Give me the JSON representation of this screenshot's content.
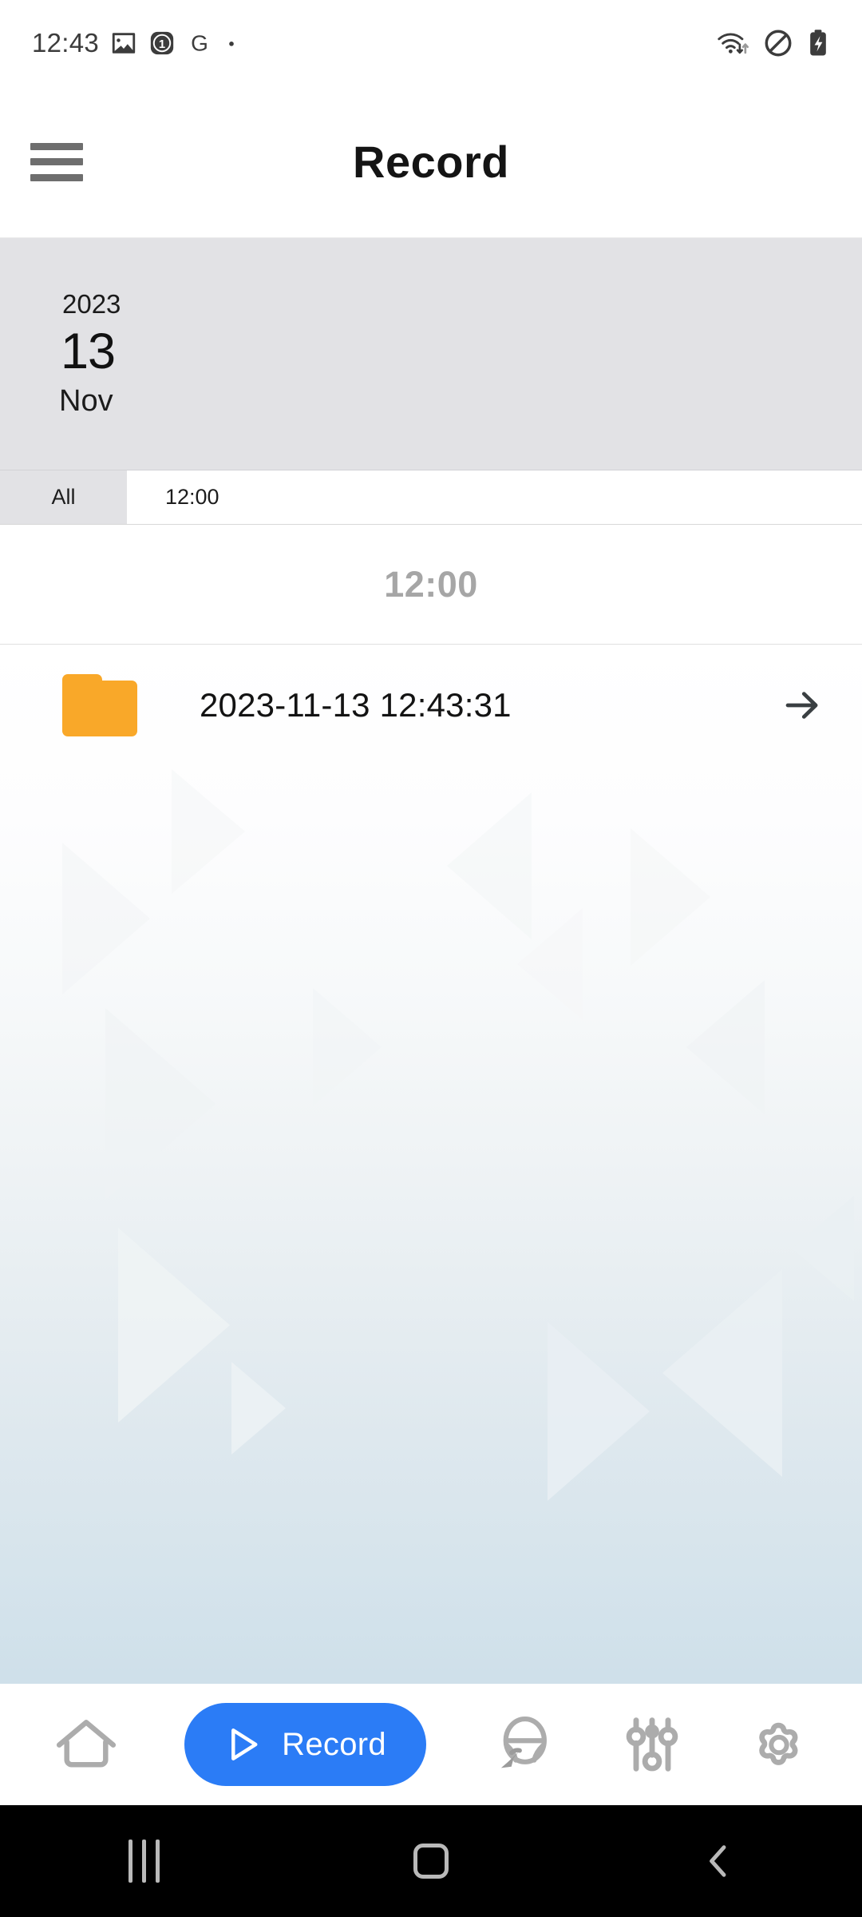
{
  "status_bar": {
    "time": "12:43",
    "left_icons": [
      "image-icon",
      "notification-count-badge",
      "google-g-icon",
      "dot-icon"
    ],
    "notification_count": "1",
    "google_letter": "G",
    "right_icons": [
      "wifi-transfer-icon",
      "do-not-disturb-icon",
      "battery-charging-icon"
    ]
  },
  "app_bar": {
    "menu_icon": "hamburger-menu-icon",
    "title": "Record"
  },
  "date_card": {
    "year": "2023",
    "day": "13",
    "month": "Nov"
  },
  "tabs": [
    {
      "label": "All",
      "selected": false
    },
    {
      "label": "12:00",
      "selected": true
    }
  ],
  "group_header": {
    "label": "12:00"
  },
  "file_list": [
    {
      "icon": "folder-icon",
      "name": "2023-11-13 12:43:31",
      "action_icon": "arrow-right-icon"
    }
  ],
  "bottom_nav": {
    "items": [
      {
        "id": "home",
        "icon": "home-icon",
        "label": ""
      },
      {
        "id": "record",
        "icon": "play-triangle-icon",
        "label": "Record",
        "active": true
      },
      {
        "id": "driving",
        "icon": "steering-wheel-icon",
        "label": ""
      },
      {
        "id": "tuning",
        "icon": "sliders-icon",
        "label": ""
      },
      {
        "id": "settings",
        "icon": "gear-icon",
        "label": ""
      }
    ]
  },
  "android_nav": {
    "recents": "recent-apps-icon",
    "home": "home-square-icon",
    "back": "back-chevron-icon"
  },
  "colors": {
    "accent_blue": "#2B7CF6",
    "folder_orange": "#F9A829",
    "card_gray": "#E2E2E5",
    "group_text_gray": "#A6A6A6",
    "nav_icon_gray": "#ACACAC",
    "background_gradient_bottom": "#CFE0EA"
  }
}
